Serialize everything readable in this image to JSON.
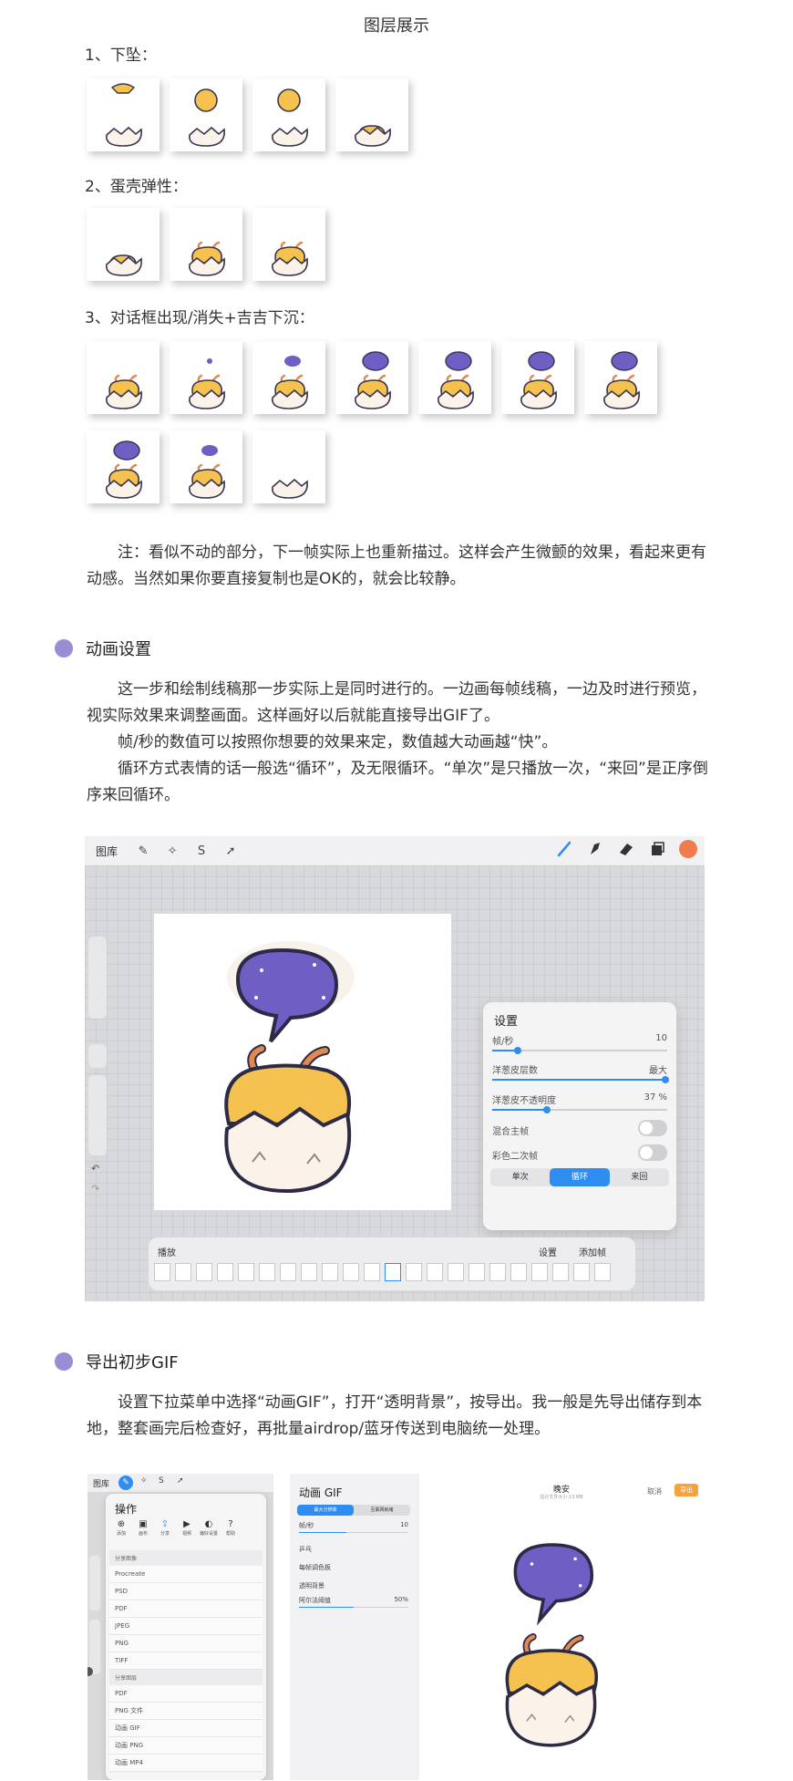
{
  "page_title": "图层展示",
  "sections": {
    "s1": "1、下坠：",
    "s2": "2、蛋壳弹性：",
    "s3": "3、对话框出现/消失+吉吉下沉："
  },
  "note": "注：看似不动的部分，下一帧实际上也重新描过。这样会产生微颤的效果，看起来更有动感。当然如果你要直接复制也是OK的，就会比较静。",
  "anim_settings": {
    "heading": "动画设置",
    "p1": "这一步和绘制线稿那一步实际上是同时进行的。一边画每帧线稿，一边及时进行预览，视实际效果来调整画面。这样画好以后就能直接导出GIF了。",
    "p2": "帧/秒的数值可以按照你想要的效果来定，数值越大动画越“快”。",
    "p3": "循环方式表情的话一般选“循环”，及无限循环。“单次”是只播放一次，“来回”是正序倒序来回循环。"
  },
  "app": {
    "gallery": "图库",
    "settings_title": "设置",
    "fps_label": "帧/秒",
    "fps_value": "10",
    "onion_layers_label": "洋葱皮层数",
    "onion_layers_value": "最大",
    "onion_opacity_label": "洋葱皮不透明度",
    "onion_opacity_value": "37 %",
    "blend_primary_label": "混合主帧",
    "color_secondary_label": "彩色二次帧",
    "loop_modes": [
      "单次",
      "循环",
      "来回"
    ],
    "playback_label": "播放",
    "settings_btn": "设置",
    "add_frame_btn": "添加帧",
    "accent_color": "#2f8cf0",
    "brush_color": "#ef7b4e"
  },
  "export": {
    "heading": "导出初步GIF",
    "p1": "设置下拉菜单中选择“动画GIF”，打开“透明背景”，按导出。我一般是先导出储存到本地，整套画完后检查好，再批量airdrop/蓝牙传送到电脑统一处理。",
    "gallery": "图库",
    "actions_title": "操作",
    "action_items": [
      "添加",
      "画布",
      "分享",
      "视频",
      "偏好设置",
      "帮助"
    ],
    "share_image_header": "分享图像",
    "share_image_items": [
      "Procreate",
      "PSD",
      "PDF",
      "JPEG",
      "PNG",
      "TIFF"
    ],
    "share_layers_header": "分享图层",
    "share_layers_items": [
      "PDF",
      "PNG 文件",
      "动画 GIF",
      "动画 PNG",
      "动画 MP4"
    ],
    "gif_title": "动画 GIF",
    "gif_modes": [
      "最大分辨率",
      "互联网就绪"
    ],
    "gif_fps_label": "帧/秒",
    "gif_fps_value": "10",
    "pingpong_label": "乒乓",
    "dither_label": "每帧调色板",
    "transparent_label": "透明背景",
    "alpha_label": "阿尔法阈值",
    "alpha_value": "50%",
    "preview_title": "晚安",
    "preview_sub": "估计文件大小:13 MB",
    "cancel": "取消",
    "export_btn": "导出"
  }
}
